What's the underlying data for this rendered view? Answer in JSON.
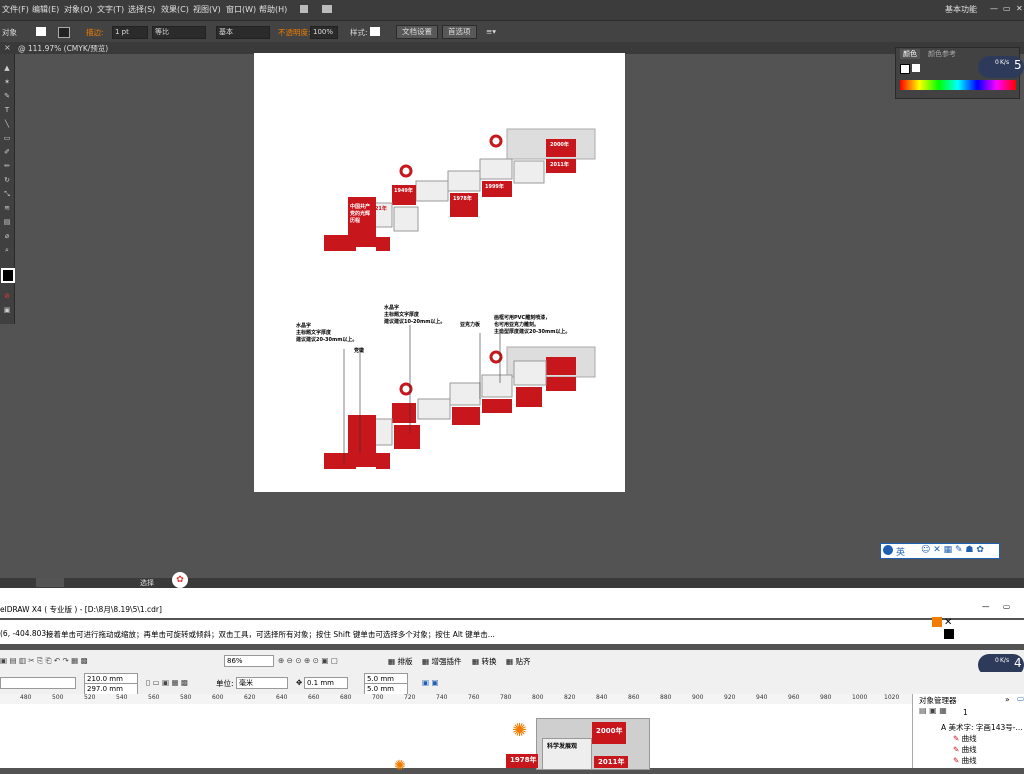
{
  "illustrator": {
    "menu": [
      "文件(F)",
      "编辑(E)",
      "对象(O)",
      "文字(T)",
      "选择(S)",
      "效果(C)",
      "视图(V)",
      "窗口(W)",
      "帮助(H)"
    ],
    "workspace": "基本功能",
    "control": {
      "selection_label": "对象",
      "stroke_label": "描边:",
      "stroke_weight": "1 pt",
      "profile": "等比",
      "brush": "基本",
      "opacity_label": "不透明度:",
      "opacity_value": "100%",
      "style_label": "样式:",
      "doc_setup": "文档设置",
      "preferences": "首选项"
    },
    "tab": "@ 111.97% (CMYK/预览)",
    "status_label": "选择",
    "color_panel": {
      "tab1": "颜色",
      "tab2": "颜色参考"
    },
    "float_badge": {
      "value": "0",
      "unit": "K/s",
      "number": "5"
    },
    "ime_bar": "英"
  },
  "artboard": {
    "top_design": {
      "years": [
        "2000年",
        "2011年",
        "1999年",
        "1978年",
        "1949年",
        "1921年"
      ],
      "title": "中国共产党的光辉历程"
    },
    "annotations": [
      {
        "text": "水晶字\n主标题文字厚度\n建议建议20-30mm以上。"
      },
      {
        "text": "水晶字\n主标题文字厚度\n建议建议10-20mm以上。"
      },
      {
        "text": "亚克力板"
      },
      {
        "text": "画框可用PVC雕刻喷漆，\n也可用亚克力雕刻。\n主造型厚度建议20-30mm以上。"
      },
      {
        "text": "党徽"
      }
    ]
  },
  "coreldraw": {
    "title": "elDRAW X4 ( 专业版 ) - [D:\\8月\\8.19\\5\\1.cdr]",
    "coords": "(6, -404.803)",
    "hint": "接着单击可进行拖动或缩放；再单击可旋转或倾斜；双击工具，可选择所有对象；按住 Shift 键单击可选择多个对象；按住 Alt 键单击...",
    "zoom": "86%",
    "menu_buttons": [
      "排版",
      "增强插件",
      "转换",
      "贴齐"
    ],
    "width": "210.0 mm",
    "height": "297.0 mm",
    "unit_label": "单位:",
    "unit_value": "毫米",
    "nudge": "0.1 mm",
    "dup_x": "5.0 mm",
    "dup_y": "5.0 mm",
    "ruler": [
      "480",
      "500",
      "520",
      "540",
      "560",
      "580",
      "600",
      "620",
      "640",
      "660",
      "680",
      "700",
      "720",
      "740",
      "760",
      "780",
      "800",
      "820",
      "840",
      "860",
      "880",
      "900",
      "920",
      "940",
      "960",
      "980",
      "1000",
      "1020"
    ],
    "obj_manager": {
      "title": "对象管理器",
      "page": "1",
      "items": [
        "美术字: 字画143号-...",
        "曲线",
        "曲线",
        "曲线"
      ]
    },
    "float_badge": {
      "value": "0",
      "unit": "K/s",
      "number": "4"
    },
    "canvas_years": [
      "2000年",
      "2011年",
      "科学发展观",
      "1978年"
    ]
  },
  "colors": {
    "red": "#c8161d",
    "ai_bg": "#535353",
    "orange": "#f07d00"
  }
}
